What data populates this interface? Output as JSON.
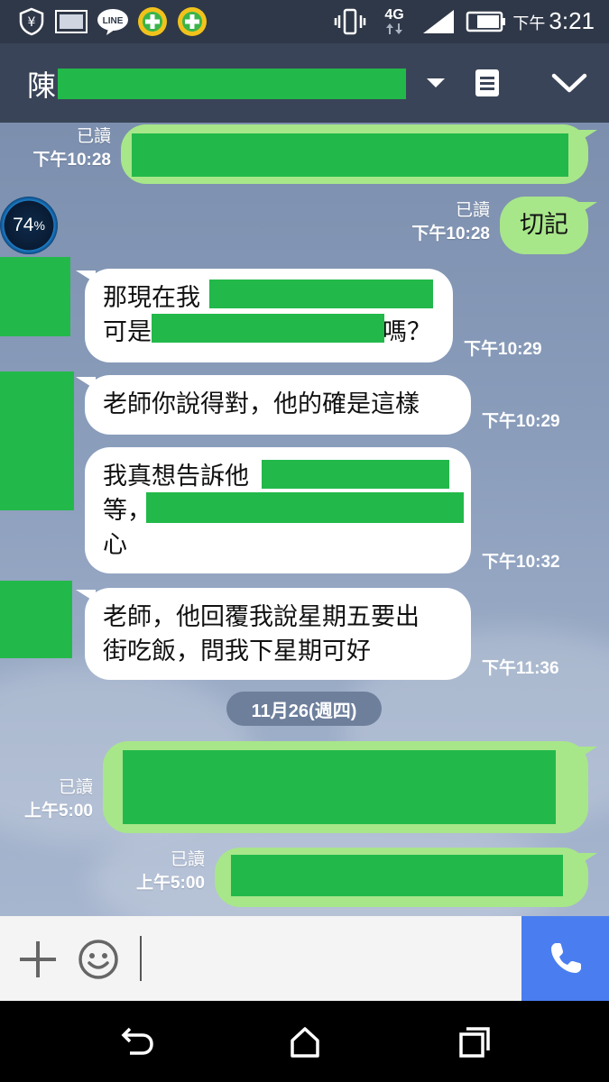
{
  "status_bar": {
    "time_ampm": "下午",
    "time": "3:21",
    "network": "4G",
    "icons": [
      "yen-shield-icon",
      "image-icon",
      "line-icon",
      "plus-app-icon",
      "plus-app-icon",
      "vibrate-icon",
      "signal-icon",
      "battery-icon"
    ]
  },
  "header": {
    "contact_initial": "陳",
    "dropdown_icon": "caret-down-icon",
    "notes_icon": "notes-icon",
    "collapse_icon": "chevron-down-icon"
  },
  "overlay": {
    "battery_percent": "74",
    "percent_sign": "%"
  },
  "messages": [
    {
      "side": "sent",
      "read": "已讀",
      "time": "下午10:28"
    },
    {
      "side": "sent",
      "read": "已讀",
      "time": "下午10:28",
      "text": "切記"
    },
    {
      "side": "recv",
      "time": "下午10:29",
      "lines": [
        "那現在我",
        "可是",
        "嗎？"
      ]
    },
    {
      "side": "recv",
      "time": "下午10:29",
      "text": "老師你說得對，他的確是這樣"
    },
    {
      "side": "recv",
      "time": "下午10:32",
      "lines": [
        "我真想告訴他",
        "等，",
        "心"
      ]
    },
    {
      "side": "recv",
      "time": "下午11:36",
      "lines": [
        "老師，他回覆我說星期五要出",
        "街吃飯，問我下星期可好"
      ]
    },
    {
      "side": "sent",
      "read": "已讀",
      "time": "上午5:00"
    },
    {
      "side": "sent",
      "read": "已讀",
      "time": "上午5:00"
    }
  ],
  "date_separator": "11月26(週四)",
  "input_bar": {
    "add_icon": "plus-icon",
    "emoji_icon": "smiley-icon",
    "call_icon": "phone-icon"
  },
  "nav_bar": {
    "icons": [
      "back-icon",
      "home-icon",
      "recents-icon"
    ]
  },
  "colors": {
    "sent_bubble": "#a8e68a",
    "recv_bubble": "#ffffff",
    "redaction": "#22b94a",
    "header": "#3a4458",
    "call_button": "#4a7ef0"
  }
}
